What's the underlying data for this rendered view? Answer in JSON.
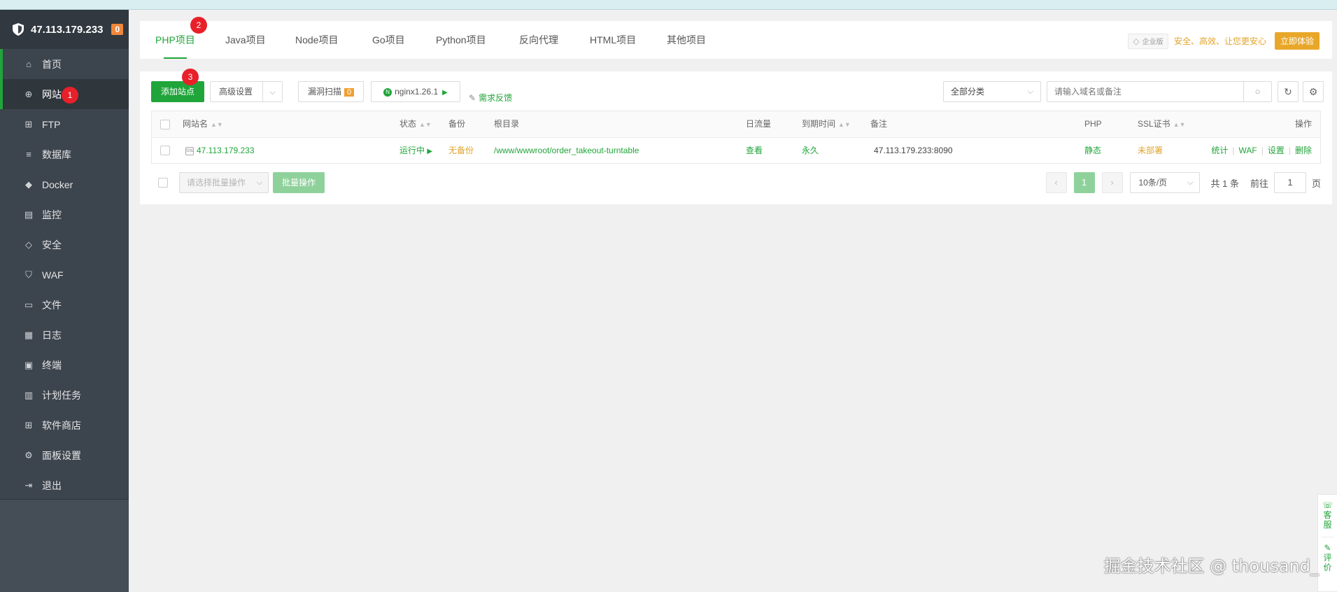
{
  "server": {
    "ip": "47.113.179.233",
    "badge": "0"
  },
  "sidebar": {
    "items": [
      {
        "label": "首页",
        "icon": "home-icon"
      },
      {
        "label": "网站",
        "icon": "globe-icon"
      },
      {
        "label": "FTP",
        "icon": "ftp-icon"
      },
      {
        "label": "数据库",
        "icon": "database-icon"
      },
      {
        "label": "Docker",
        "icon": "docker-icon"
      },
      {
        "label": "监控",
        "icon": "monitor-icon"
      },
      {
        "label": "安全",
        "icon": "shield-icon"
      },
      {
        "label": "WAF",
        "icon": "waf-icon"
      },
      {
        "label": "文件",
        "icon": "folder-icon"
      },
      {
        "label": "日志",
        "icon": "log-icon"
      },
      {
        "label": "终端",
        "icon": "terminal-icon"
      },
      {
        "label": "计划任务",
        "icon": "calendar-icon"
      },
      {
        "label": "软件商店",
        "icon": "apps-icon"
      },
      {
        "label": "面板设置",
        "icon": "gear-icon"
      },
      {
        "label": "退出",
        "icon": "logout-icon"
      }
    ]
  },
  "markers": [
    "1",
    "2",
    "3"
  ],
  "tabs": [
    "PHP项目",
    "Java项目",
    "Node项目",
    "Go项目",
    "Python项目",
    "反向代理",
    "HTML项目",
    "其他项目"
  ],
  "promo": {
    "badge": "企业版",
    "slogan": "安全、高效、让您更安心",
    "button": "立即体验"
  },
  "toolbar": {
    "add_site": "添加站点",
    "advanced": "高级设置",
    "vuln_scan": "漏洞扫描",
    "vuln_count": "0",
    "nginx": "nginx1.26.1",
    "feedback": "需求反馈",
    "category": "全部分类",
    "search_placeholder": "请输入域名或备注"
  },
  "table": {
    "headers": {
      "name": "网站名",
      "status": "状态",
      "backup": "备份",
      "root": "根目录",
      "traffic": "日流量",
      "expire": "到期时间",
      "remark": "备注",
      "php": "PHP",
      "ssl": "SSL证书",
      "ops": "操作"
    },
    "rows": [
      {
        "name": "47.113.179.233",
        "status": "运行中",
        "backup": "无备份",
        "root": "/www/wwwroot/order_takeout-turntable",
        "traffic": "查看",
        "expire": "永久",
        "remark": "47.113.179.233:8090",
        "php": "静态",
        "ssl": "未部署",
        "ops": [
          "统计",
          "WAF",
          "设置",
          "删除"
        ]
      }
    ]
  },
  "footer": {
    "batch_placeholder": "请选择批量操作",
    "batch_button": "批量操作",
    "current_page": "1",
    "per_page": "10条/页",
    "total": "共 1 条",
    "goto_label": "前往",
    "goto_value": "1",
    "page_suffix": "页"
  },
  "float": {
    "service": "客服",
    "review": "评价"
  },
  "watermark": "掘金技术社区 @ thousand_",
  "colors": {
    "accent": "#20a53a",
    "sidebar": "#3c444d",
    "warning": "#e2a42d",
    "marker": "#e8202a"
  }
}
